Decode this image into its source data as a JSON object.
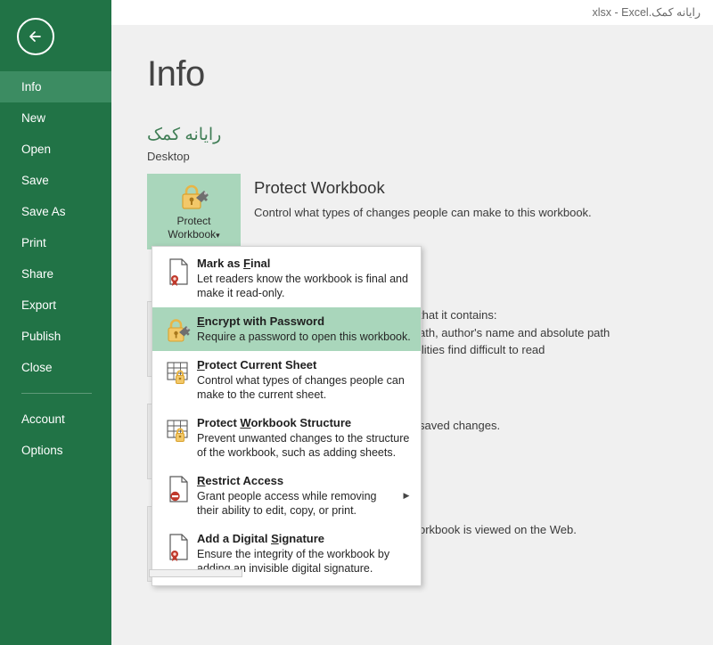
{
  "titlebar": {
    "text": "رایانه کمک.xlsx - Excel"
  },
  "sidebar": {
    "back_icon": "back-arrow-icon",
    "items": [
      {
        "label": "Info",
        "active": true
      },
      {
        "label": "New",
        "active": false
      },
      {
        "label": "Open",
        "active": false
      },
      {
        "label": "Save",
        "active": false
      },
      {
        "label": "Save As",
        "active": false
      },
      {
        "label": "Print",
        "active": false
      },
      {
        "label": "Share",
        "active": false
      },
      {
        "label": "Export",
        "active": false
      },
      {
        "label": "Publish",
        "active": false
      },
      {
        "label": "Close",
        "active": false
      }
    ],
    "footer_items": [
      {
        "label": "Account"
      },
      {
        "label": "Options"
      }
    ]
  },
  "main": {
    "page_title": "Info",
    "file_name": "رایانه کمک",
    "file_path": "Desktop",
    "protect": {
      "button_label_line1": "Protect",
      "button_label_line2": "Workbook",
      "button_caret": "▾",
      "icon": "padlock-key-icon",
      "heading": "Protect Workbook",
      "description": "Control what types of changes people can make to this workbook."
    },
    "background_text": {
      "inspect_line1": "that it contains:",
      "inspect_line2": "ath, author's name and absolute path",
      "inspect_line3": "ilities find difficult to read",
      "versions_line1": "saved changes.",
      "versions_line2": ".",
      "browser_line1": "orkbook is viewed on the Web."
    }
  },
  "menu": {
    "items": [
      {
        "icon": "document-seal-icon",
        "title_pre": "Mark as ",
        "title_accel": "F",
        "title_post": "inal",
        "desc": "Let readers know the workbook is final and make it read-only.",
        "selected": false,
        "has_submenu": false
      },
      {
        "icon": "padlock-key-icon",
        "title_pre": "",
        "title_accel": "E",
        "title_post": "ncrypt with Password",
        "desc": "Require a password to open this workbook.",
        "selected": true,
        "has_submenu": false
      },
      {
        "icon": "sheet-lock-icon",
        "title_pre": "",
        "title_accel": "P",
        "title_post": "rotect Current Sheet",
        "desc": "Control what types of changes people can make to the current sheet.",
        "selected": false,
        "has_submenu": false
      },
      {
        "icon": "workbook-lock-icon",
        "title_pre": "Protect ",
        "title_accel": "W",
        "title_post": "orkbook Structure",
        "desc": "Prevent unwanted changes to the structure of the workbook, such as adding sheets.",
        "selected": false,
        "has_submenu": false
      },
      {
        "icon": "document-restrict-icon",
        "title_pre": "",
        "title_accel": "R",
        "title_post": "estrict Access",
        "desc": "Grant people access while removing their ability to edit, copy, or print.",
        "selected": false,
        "has_submenu": true,
        "submenu_arrow": "▶"
      },
      {
        "icon": "document-signature-icon",
        "title_pre": "Add a Digital ",
        "title_accel": "S",
        "title_post": "ignature",
        "desc": "Ensure the integrity of the workbook by adding an invisible digital signature.",
        "selected": false,
        "has_submenu": false
      }
    ]
  },
  "colors": {
    "sidebar_green": "#217346",
    "sidebar_active_green": "#3c8c62",
    "accent_light_green": "#a9d6bb",
    "file_name_green": "#3f7d55",
    "canvas_gray": "#f0f0f0",
    "gold": "#e8b546",
    "red": "#c0392b"
  }
}
